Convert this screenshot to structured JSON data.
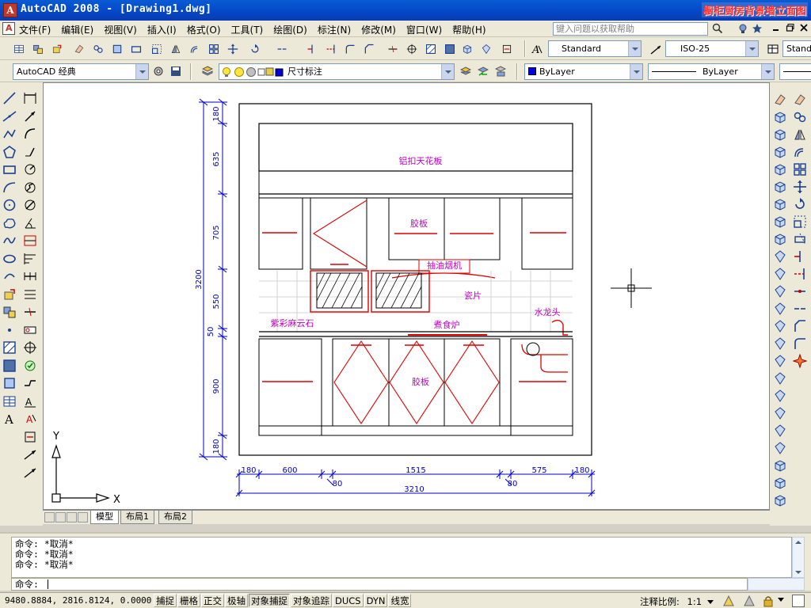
{
  "window": {
    "title": "AutoCAD 2008 - [Drawing1.dwg]",
    "banner": "橱柜厨房背景墙立面图"
  },
  "menu": {
    "items": [
      "文件(F)",
      "编辑(E)",
      "视图(V)",
      "插入(I)",
      "格式(O)",
      "工具(T)",
      "绘图(D)",
      "标注(N)",
      "修改(M)",
      "窗口(W)",
      "帮助(H)"
    ],
    "help_placeholder": "键入问题以获取帮助"
  },
  "toolbar_styles": {
    "text_style": "Standard",
    "dim_style": "ISO-25",
    "table_style": "Standard"
  },
  "toolbar_layers": {
    "workspace": "AutoCAD 经典",
    "layer": "尺寸标注",
    "color": "ByLayer",
    "linetype": "ByLayer"
  },
  "drawing": {
    "labels": {
      "ceiling": "铝扣天花板",
      "upper_panel": "胶板",
      "hood": "抽油烟机",
      "tile": "瓷片",
      "faucet": "水龙头",
      "countertop": "紫彩麻云石",
      "stove": "煮食炉",
      "lower_panel": "胶板"
    },
    "dims_vertical": [
      "180",
      "635",
      "705",
      "550",
      "50",
      "900",
      "180"
    ],
    "dim_vertical_total": "3200",
    "dims_horizontal": [
      "180",
      "600",
      "80",
      "1515",
      "80",
      "575",
      "180"
    ],
    "dim_horizontal_total": "3210",
    "ucs": {
      "x": "X",
      "y": "Y"
    }
  },
  "tabs": {
    "items": [
      "模型",
      "布局1",
      "布局2"
    ],
    "active": "模型"
  },
  "command": {
    "history": [
      "命令: *取消*",
      "命令: *取消*",
      "命令: *取消*"
    ],
    "prompt": "命令:"
  },
  "status": {
    "coords": "9480.8884, 2816.8124, 0.0000",
    "toggles": [
      "捕捉",
      "栅格",
      "正交",
      "极轴",
      "对象捕捉",
      "对象追踪",
      "DUCS",
      "DYN",
      "线宽"
    ],
    "toggles_on": [
      "对象捕捉"
    ],
    "annotation_scale_label": "注释比例:",
    "annotation_scale": "1:1"
  },
  "colors": {
    "magenta_text": "#c000c0",
    "red_line": "#e00000",
    "dim_blue": "#0000c8",
    "title_blue": "#0a4ec8"
  }
}
